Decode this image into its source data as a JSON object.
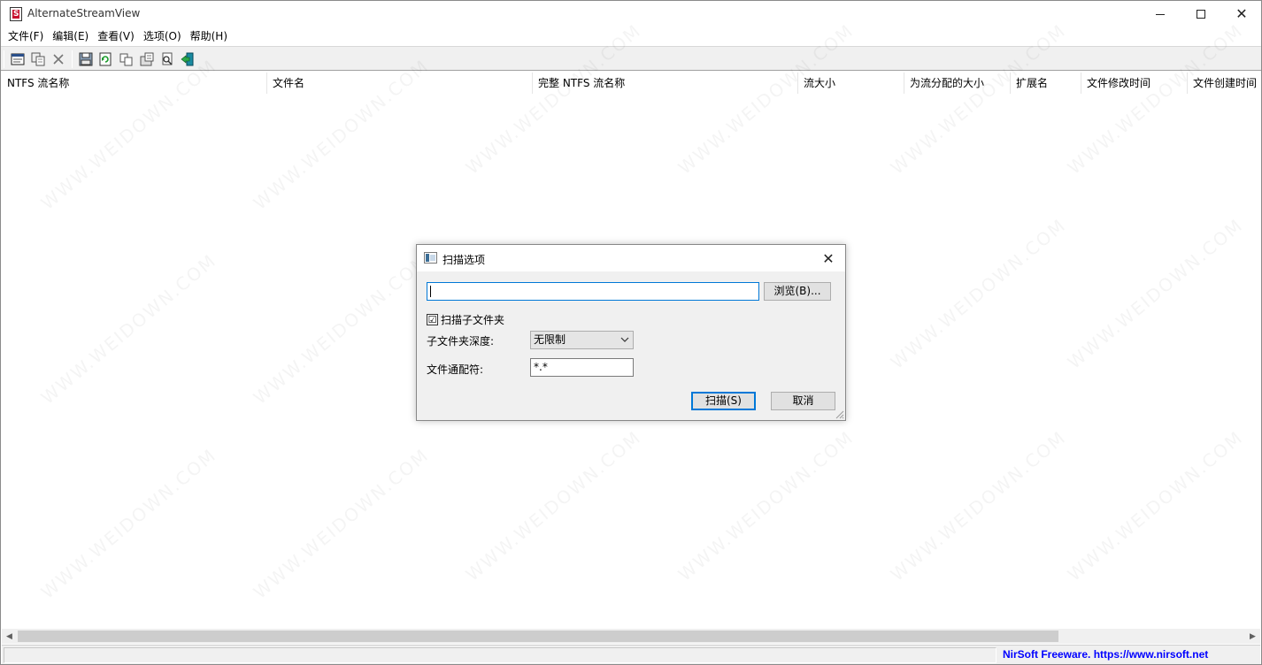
{
  "window": {
    "title": "AlternateStreamView"
  },
  "menu": [
    {
      "label": "文件(F)"
    },
    {
      "label": "编辑(E)"
    },
    {
      "label": "查看(V)"
    },
    {
      "label": "选项(O)"
    },
    {
      "label": "帮助(H)"
    }
  ],
  "toolbar": {
    "buttons": [
      {
        "icon": "scan-options-icon"
      },
      {
        "icon": "copy-stream-icon"
      },
      {
        "icon": "delete-icon"
      },
      {
        "icon": "save-icon"
      },
      {
        "icon": "refresh-icon"
      },
      {
        "icon": "copy-icon"
      },
      {
        "icon": "properties-icon"
      },
      {
        "icon": "find-icon"
      },
      {
        "icon": "exit-icon"
      }
    ]
  },
  "columns": [
    {
      "label": "NTFS 流名称"
    },
    {
      "label": "文件名"
    },
    {
      "label": "完整 NTFS 流名称"
    },
    {
      "label": "流大小"
    },
    {
      "label": "为流分配的大小"
    },
    {
      "label": "扩展名"
    },
    {
      "label": "文件修改时间"
    },
    {
      "label": "文件创建时间"
    }
  ],
  "status": {
    "link_text": "NirSoft Freeware. https://www.nirsoft.net",
    "link_color": "#0000ff"
  },
  "dialog": {
    "title": "扫描选项",
    "path_value": "",
    "browse_label": "浏览(B)...",
    "scan_subfolders_label": "扫描子文件夹",
    "scan_subfolders_checked": "☑",
    "depth_label": "子文件夹深度:",
    "depth_value": "无限制",
    "wildcard_label": "文件通配符:",
    "wildcard_value": "*.*",
    "scan_label": "扫描(S)",
    "cancel_label": "取消"
  },
  "watermark": "WWW.WEIDOWN.COM"
}
